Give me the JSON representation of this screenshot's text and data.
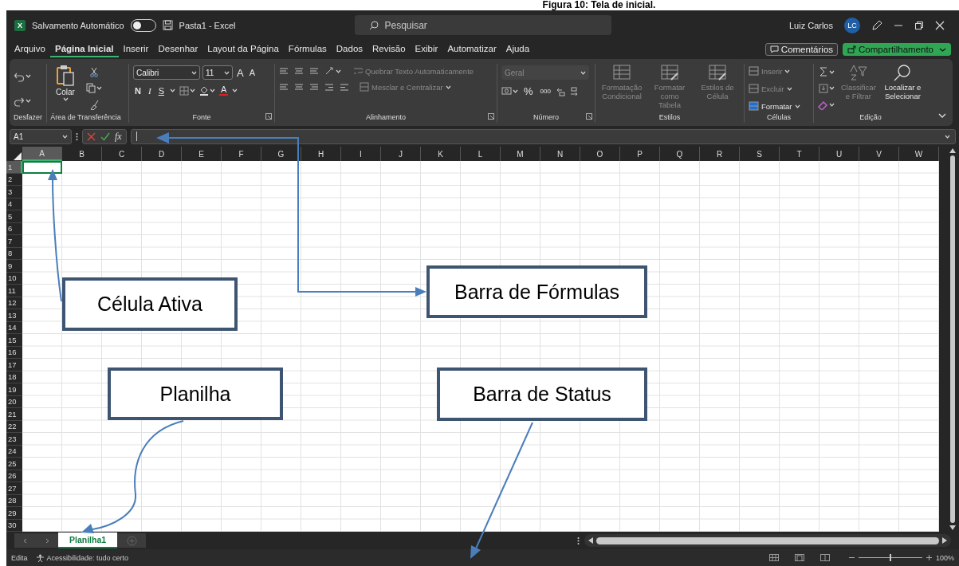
{
  "caption": "Figura 10: Tela de inicial.",
  "title_bar": {
    "app_icon_letter": "X",
    "autosave_label": "Salvamento Automático",
    "autosave_on": false,
    "document_title": "Pasta1  -  Excel",
    "search_placeholder": "Pesquisar",
    "user_name": "Luiz Carlos",
    "user_initials": "LC"
  },
  "menu_tabs": [
    {
      "label": "Arquivo",
      "selected": false
    },
    {
      "label": "Página Inicial",
      "selected": true
    },
    {
      "label": "Inserir",
      "selected": false
    },
    {
      "label": "Desenhar",
      "selected": false
    },
    {
      "label": "Layout da Página",
      "selected": false
    },
    {
      "label": "Fórmulas",
      "selected": false
    },
    {
      "label": "Dados",
      "selected": false
    },
    {
      "label": "Revisão",
      "selected": false
    },
    {
      "label": "Exibir",
      "selected": false
    },
    {
      "label": "Automatizar",
      "selected": false
    },
    {
      "label": "Ajuda",
      "selected": false
    }
  ],
  "comments_button": "Comentários",
  "share_button": "Compartilhamento",
  "ribbon": {
    "undo": {
      "label": "Desfazer"
    },
    "clipboard": {
      "label": "Área de Transferência",
      "paste": "Colar"
    },
    "font": {
      "label": "Fonte",
      "font_name": "Calibri",
      "font_size": "11",
      "grow": "A",
      "shrink": "A",
      "bold": "N",
      "italic": "I",
      "underline": "S",
      "color_letter": "A"
    },
    "alignment": {
      "label": "Alinhamento",
      "wrap_text": {
        "label": "Quebrar Texto Automaticamente",
        "disabled": true
      },
      "merge_center": {
        "label": "Mesclar e Centralizar",
        "disabled": true
      }
    },
    "number": {
      "label": "Número",
      "format": {
        "label": "Geral",
        "disabled": true
      },
      "percent": "%",
      "thousands": "000"
    },
    "styles": {
      "label": "Estilos",
      "items": [
        {
          "label": "Formatação Condicional",
          "disabled": true
        },
        {
          "label": "Formatar como Tabela",
          "disabled": true
        },
        {
          "label": "Estilos de Célula",
          "disabled": true
        }
      ]
    },
    "cells": {
      "label": "Células",
      "items": [
        {
          "label": "Inserir",
          "disabled": true
        },
        {
          "label": "Excluir",
          "disabled": true
        },
        {
          "label": "Formatar",
          "disabled": false
        }
      ]
    },
    "editing": {
      "label": "Edição",
      "sort_filter": {
        "label": "Classificar e Filtrar",
        "disabled": true
      },
      "find_select": {
        "label": "Localizar e Selecionar",
        "disabled": false
      }
    }
  },
  "formula_bar": {
    "name_box": "A1",
    "function_label": "fx"
  },
  "columns": [
    {
      "label": "A",
      "selected": true
    },
    {
      "label": "B",
      "selected": false
    },
    {
      "label": "C",
      "selected": false
    },
    {
      "label": "D",
      "selected": false
    },
    {
      "label": "E",
      "selected": false
    },
    {
      "label": "F",
      "selected": false
    },
    {
      "label": "G",
      "selected": false
    },
    {
      "label": "H",
      "selected": false
    },
    {
      "label": "I",
      "selected": false
    },
    {
      "label": "J",
      "selected": false
    },
    {
      "label": "K",
      "selected": false
    },
    {
      "label": "L",
      "selected": false
    },
    {
      "label": "M",
      "selected": false
    },
    {
      "label": "N",
      "selected": false
    },
    {
      "label": "O",
      "selected": false
    },
    {
      "label": "P",
      "selected": false
    },
    {
      "label": "Q",
      "selected": false
    },
    {
      "label": "R",
      "selected": false
    },
    {
      "label": "S",
      "selected": false
    },
    {
      "label": "T",
      "selected": false
    },
    {
      "label": "U",
      "selected": false
    },
    {
      "label": "V",
      "selected": false
    },
    {
      "label": "W",
      "selected": false
    }
  ],
  "rows": [
    {
      "label": "1",
      "selected": true
    },
    {
      "label": "2",
      "selected": false
    },
    {
      "label": "3",
      "selected": false
    },
    {
      "label": "4",
      "selected": false
    },
    {
      "label": "5",
      "selected": false
    },
    {
      "label": "6",
      "selected": false
    },
    {
      "label": "7",
      "selected": false
    },
    {
      "label": "8",
      "selected": false
    },
    {
      "label": "9",
      "selected": false
    },
    {
      "label": "10",
      "selected": false
    },
    {
      "label": "11",
      "selected": false
    },
    {
      "label": "12",
      "selected": false
    },
    {
      "label": "13",
      "selected": false
    },
    {
      "label": "14",
      "selected": false
    },
    {
      "label": "15",
      "selected": false
    },
    {
      "label": "16",
      "selected": false
    },
    {
      "label": "17",
      "selected": false
    },
    {
      "label": "18",
      "selected": false
    },
    {
      "label": "19",
      "selected": false
    },
    {
      "label": "20",
      "selected": false
    },
    {
      "label": "21",
      "selected": false
    },
    {
      "label": "22",
      "selected": false
    },
    {
      "label": "23",
      "selected": false
    },
    {
      "label": "24",
      "selected": false
    },
    {
      "label": "25",
      "selected": false
    },
    {
      "label": "26",
      "selected": false
    },
    {
      "label": "27",
      "selected": false
    },
    {
      "label": "28",
      "selected": false
    },
    {
      "label": "29",
      "selected": false
    },
    {
      "label": "30",
      "selected": false
    }
  ],
  "sheet_tabs": [
    {
      "label": "Planilha1",
      "selected": true
    }
  ],
  "status_bar": {
    "mode": "Edita",
    "accessibility": "Acessibilidade: tudo certo",
    "zoom": {
      "level": 0.5,
      "reading": "100%"
    }
  },
  "annotations": [
    {
      "label": "Célula Ativa"
    },
    {
      "label": "Barra de Fórmulas"
    },
    {
      "label": "Planilha"
    },
    {
      "label": "Barra de Status"
    }
  ]
}
